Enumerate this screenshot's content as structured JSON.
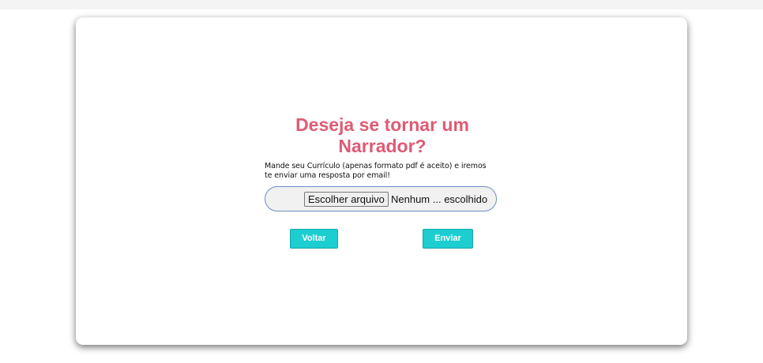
{
  "form": {
    "title": "Deseja se tornar um Narrador?",
    "instructions": "Mande seu Currículo (apenas formato pdf é aceito) e iremos te enviar uma resposta por email!",
    "file_button_label": "Escolher arquivo",
    "file_status": "Nenhum ... escolhido"
  },
  "actions": {
    "back_label": "Voltar",
    "submit_label": "Enviar"
  },
  "colors": {
    "title": "#de5b74",
    "button_bg": "#1ccecf",
    "input_border": "#6f8ec4"
  }
}
